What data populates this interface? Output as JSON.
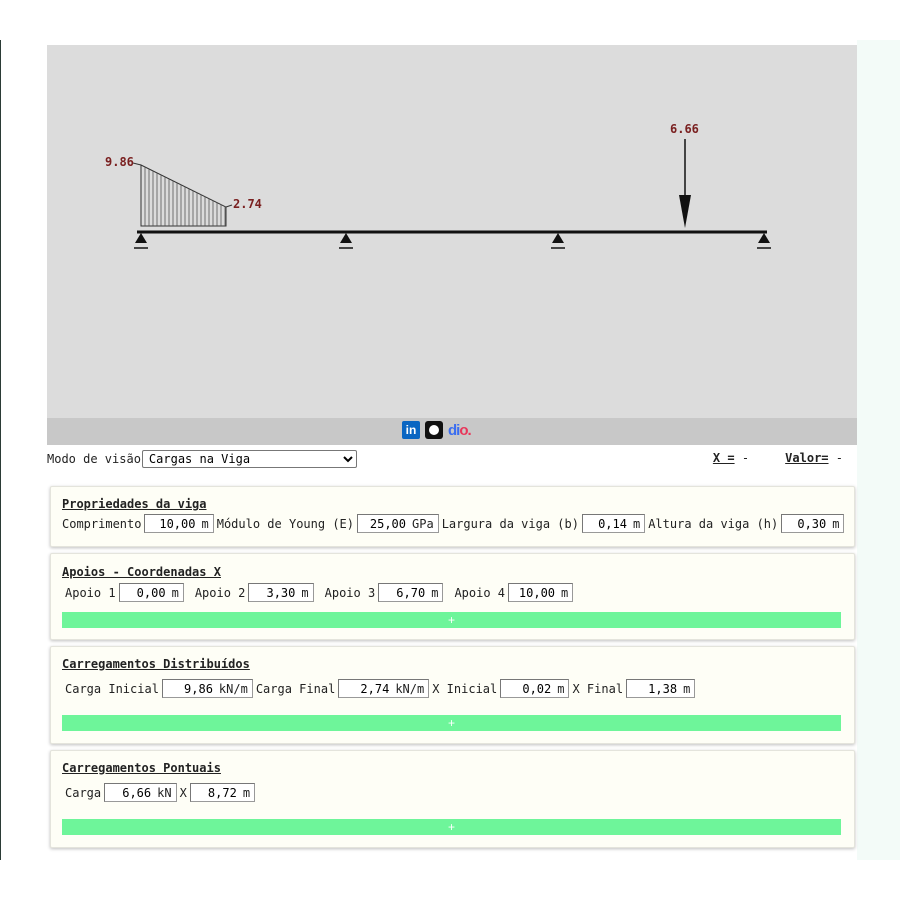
{
  "diagram": {
    "dist_start_value": "9.86",
    "dist_end_value": "2.74",
    "point_load_value": "6.66"
  },
  "footer": {
    "icons": [
      "linkedin-icon",
      "github-icon",
      "dio-logo"
    ],
    "dio_text_a": "di",
    "dio_text_b": "o."
  },
  "view": {
    "label": "Modo de visão",
    "selected": "Cargas na Viga",
    "x_label": "X =",
    "x_value": "-",
    "valor_label": "Valor=",
    "valor_value": "-"
  },
  "beam": {
    "title": "Propriedades da viga",
    "comprimento_label": "Comprimento",
    "comprimento_value": "10,00",
    "comprimento_unit": "m",
    "young_label": "Módulo de Young (E)",
    "young_value": "25,00",
    "young_unit": "GPa",
    "largura_label": "Largura da viga (b)",
    "largura_value": "0,14",
    "largura_unit": "m",
    "altura_label": "Altura da viga (h)",
    "altura_value": "0,30",
    "altura_unit": "m"
  },
  "supports": {
    "title": "Apoios - Coordenadas X",
    "items": [
      {
        "label": "Apoio 1",
        "value": "0,00",
        "unit": "m"
      },
      {
        "label": "Apoio 2",
        "value": "3,30",
        "unit": "m"
      },
      {
        "label": "Apoio 3",
        "value": "6,70",
        "unit": "m"
      },
      {
        "label": "Apoio 4",
        "value": "10,00",
        "unit": "m"
      }
    ],
    "add_label": "+"
  },
  "distributed": {
    "title": "Carregamentos Distribuídos",
    "inicial_label": "Carga Inicial",
    "inicial_value": "9,86",
    "inicial_unit": "kN/m",
    "final_label": "Carga Final",
    "final_value": "2,74",
    "final_unit": "kN/m",
    "x_inicial_label": "X Inicial",
    "x_inicial_value": "0,02",
    "x_inicial_unit": "m",
    "x_final_label": "X Final",
    "x_final_value": "1,38",
    "x_final_unit": "m",
    "add_label": "+"
  },
  "point": {
    "title": "Carregamentos Pontuais",
    "carga_label": "Carga",
    "carga_value": "6,66",
    "carga_unit": "kN",
    "x_label": "X",
    "x_value": "8,72",
    "x_unit": "m",
    "add_label": "+"
  },
  "colors": {
    "canvas_bg": "#dcdcdc",
    "footer_bg": "#c8c8c8",
    "card_bg": "#fefef6",
    "add_bar": "#6ef59a",
    "load_label": "#7a2020"
  }
}
